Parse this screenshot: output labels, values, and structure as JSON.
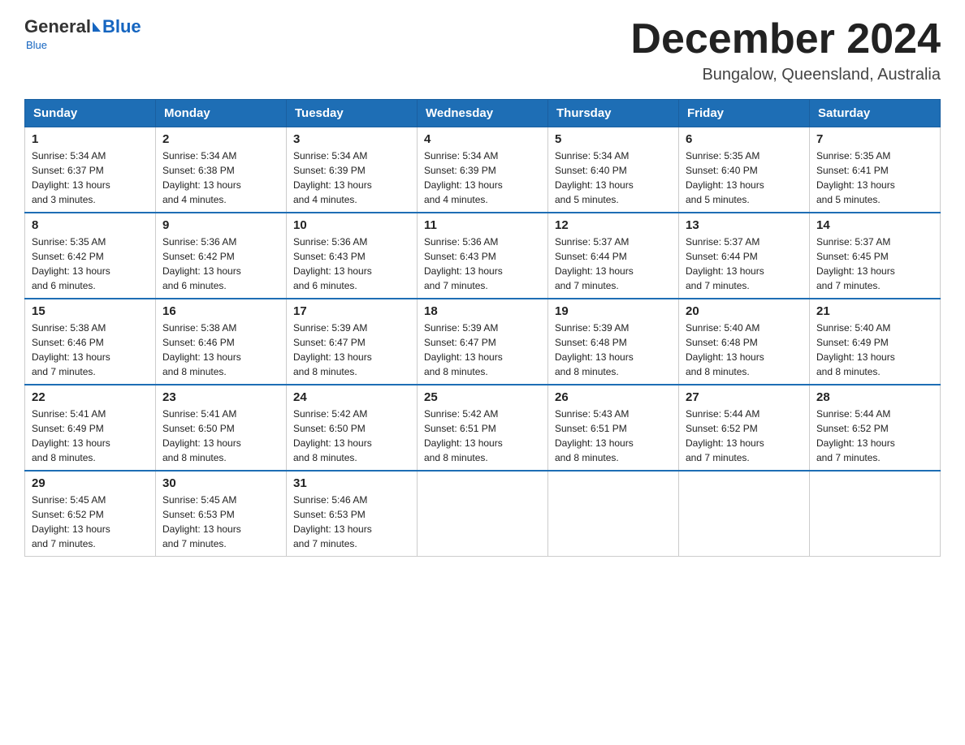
{
  "header": {
    "logo_general": "General",
    "logo_blue": "Blue",
    "main_title": "December 2024",
    "subtitle": "Bungalow, Queensland, Australia"
  },
  "days_of_week": [
    "Sunday",
    "Monday",
    "Tuesday",
    "Wednesday",
    "Thursday",
    "Friday",
    "Saturday"
  ],
  "weeks": [
    [
      {
        "day": "1",
        "sunrise": "5:34 AM",
        "sunset": "6:37 PM",
        "daylight": "13 hours and 3 minutes."
      },
      {
        "day": "2",
        "sunrise": "5:34 AM",
        "sunset": "6:38 PM",
        "daylight": "13 hours and 4 minutes."
      },
      {
        "day": "3",
        "sunrise": "5:34 AM",
        "sunset": "6:39 PM",
        "daylight": "13 hours and 4 minutes."
      },
      {
        "day": "4",
        "sunrise": "5:34 AM",
        "sunset": "6:39 PM",
        "daylight": "13 hours and 4 minutes."
      },
      {
        "day": "5",
        "sunrise": "5:34 AM",
        "sunset": "6:40 PM",
        "daylight": "13 hours and 5 minutes."
      },
      {
        "day": "6",
        "sunrise": "5:35 AM",
        "sunset": "6:40 PM",
        "daylight": "13 hours and 5 minutes."
      },
      {
        "day": "7",
        "sunrise": "5:35 AM",
        "sunset": "6:41 PM",
        "daylight": "13 hours and 5 minutes."
      }
    ],
    [
      {
        "day": "8",
        "sunrise": "5:35 AM",
        "sunset": "6:42 PM",
        "daylight": "13 hours and 6 minutes."
      },
      {
        "day": "9",
        "sunrise": "5:36 AM",
        "sunset": "6:42 PM",
        "daylight": "13 hours and 6 minutes."
      },
      {
        "day": "10",
        "sunrise": "5:36 AM",
        "sunset": "6:43 PM",
        "daylight": "13 hours and 6 minutes."
      },
      {
        "day": "11",
        "sunrise": "5:36 AM",
        "sunset": "6:43 PM",
        "daylight": "13 hours and 7 minutes."
      },
      {
        "day": "12",
        "sunrise": "5:37 AM",
        "sunset": "6:44 PM",
        "daylight": "13 hours and 7 minutes."
      },
      {
        "day": "13",
        "sunrise": "5:37 AM",
        "sunset": "6:44 PM",
        "daylight": "13 hours and 7 minutes."
      },
      {
        "day": "14",
        "sunrise": "5:37 AM",
        "sunset": "6:45 PM",
        "daylight": "13 hours and 7 minutes."
      }
    ],
    [
      {
        "day": "15",
        "sunrise": "5:38 AM",
        "sunset": "6:46 PM",
        "daylight": "13 hours and 7 minutes."
      },
      {
        "day": "16",
        "sunrise": "5:38 AM",
        "sunset": "6:46 PM",
        "daylight": "13 hours and 8 minutes."
      },
      {
        "day": "17",
        "sunrise": "5:39 AM",
        "sunset": "6:47 PM",
        "daylight": "13 hours and 8 minutes."
      },
      {
        "day": "18",
        "sunrise": "5:39 AM",
        "sunset": "6:47 PM",
        "daylight": "13 hours and 8 minutes."
      },
      {
        "day": "19",
        "sunrise": "5:39 AM",
        "sunset": "6:48 PM",
        "daylight": "13 hours and 8 minutes."
      },
      {
        "day": "20",
        "sunrise": "5:40 AM",
        "sunset": "6:48 PM",
        "daylight": "13 hours and 8 minutes."
      },
      {
        "day": "21",
        "sunrise": "5:40 AM",
        "sunset": "6:49 PM",
        "daylight": "13 hours and 8 minutes."
      }
    ],
    [
      {
        "day": "22",
        "sunrise": "5:41 AM",
        "sunset": "6:49 PM",
        "daylight": "13 hours and 8 minutes."
      },
      {
        "day": "23",
        "sunrise": "5:41 AM",
        "sunset": "6:50 PM",
        "daylight": "13 hours and 8 minutes."
      },
      {
        "day": "24",
        "sunrise": "5:42 AM",
        "sunset": "6:50 PM",
        "daylight": "13 hours and 8 minutes."
      },
      {
        "day": "25",
        "sunrise": "5:42 AM",
        "sunset": "6:51 PM",
        "daylight": "13 hours and 8 minutes."
      },
      {
        "day": "26",
        "sunrise": "5:43 AM",
        "sunset": "6:51 PM",
        "daylight": "13 hours and 8 minutes."
      },
      {
        "day": "27",
        "sunrise": "5:44 AM",
        "sunset": "6:52 PM",
        "daylight": "13 hours and 7 minutes."
      },
      {
        "day": "28",
        "sunrise": "5:44 AM",
        "sunset": "6:52 PM",
        "daylight": "13 hours and 7 minutes."
      }
    ],
    [
      {
        "day": "29",
        "sunrise": "5:45 AM",
        "sunset": "6:52 PM",
        "daylight": "13 hours and 7 minutes."
      },
      {
        "day": "30",
        "sunrise": "5:45 AM",
        "sunset": "6:53 PM",
        "daylight": "13 hours and 7 minutes."
      },
      {
        "day": "31",
        "sunrise": "5:46 AM",
        "sunset": "6:53 PM",
        "daylight": "13 hours and 7 minutes."
      },
      null,
      null,
      null,
      null
    ]
  ],
  "labels": {
    "sunrise": "Sunrise:",
    "sunset": "Sunset:",
    "daylight": "Daylight:"
  }
}
